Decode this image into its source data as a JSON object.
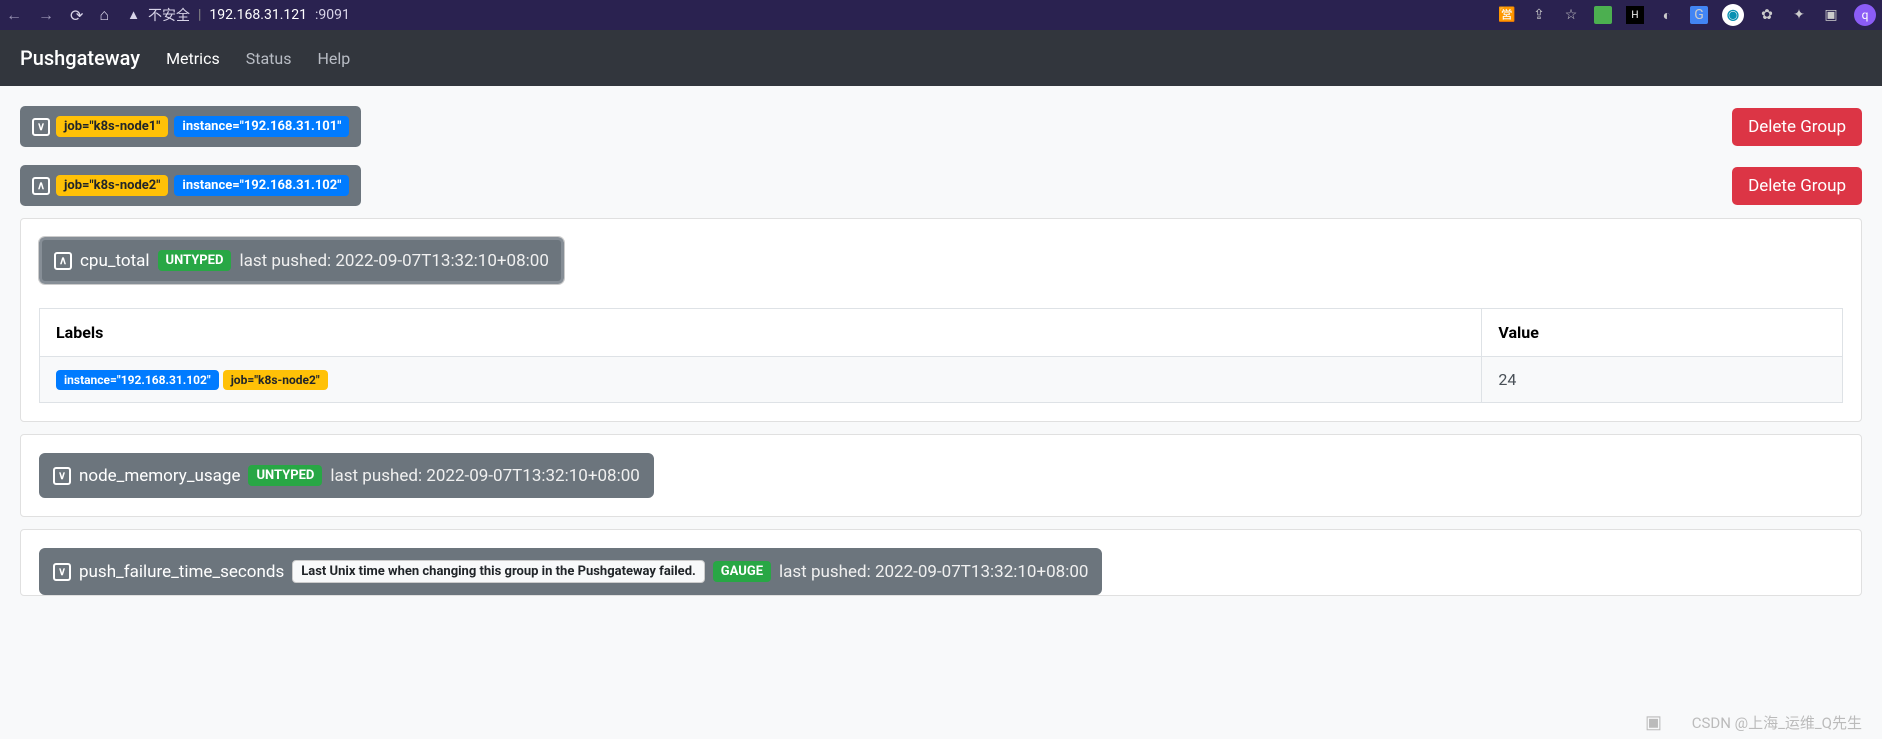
{
  "browser": {
    "insecure_label": "不安全",
    "addr_host": "192.168.31.121",
    "addr_port": ":9091",
    "avatar_letter": "q"
  },
  "nav": {
    "brand": "Pushgateway",
    "links": {
      "metrics": "Metrics",
      "status": "Status",
      "help": "Help"
    }
  },
  "delete_group_label": "Delete Group",
  "groups": [
    {
      "job_label": "job=\"k8s-node1\"",
      "instance_label": "instance=\"192.168.31.101\"",
      "toggle_glyph": "∨"
    },
    {
      "job_label": "job=\"k8s-node2\"",
      "instance_label": "instance=\"192.168.31.102\"",
      "toggle_glyph": "∧"
    }
  ],
  "table": {
    "labels_header": "Labels",
    "value_header": "Value",
    "row": {
      "instance_label": "instance=\"192.168.31.102\"",
      "job_label": "job=\"k8s-node2\"",
      "value": "24"
    }
  },
  "metrics": {
    "cpu": {
      "name": "cpu_total",
      "type": "UNTYPED",
      "pushed": "last pushed: 2022-09-07T13:32:10+08:00",
      "toggle_glyph": "∧"
    },
    "mem": {
      "name": "node_memory_usage",
      "type": "UNTYPED",
      "pushed": "last pushed: 2022-09-07T13:32:10+08:00",
      "toggle_glyph": "∨"
    },
    "fail": {
      "name": "push_failure_time_seconds",
      "help": "Last Unix time when changing this group in the Pushgateway failed.",
      "type": "GAUGE",
      "pushed": "last pushed: 2022-09-07T13:32:10+08:00",
      "toggle_glyph": "∨"
    }
  },
  "watermark": "CSDN @上海_运维_Q先生"
}
